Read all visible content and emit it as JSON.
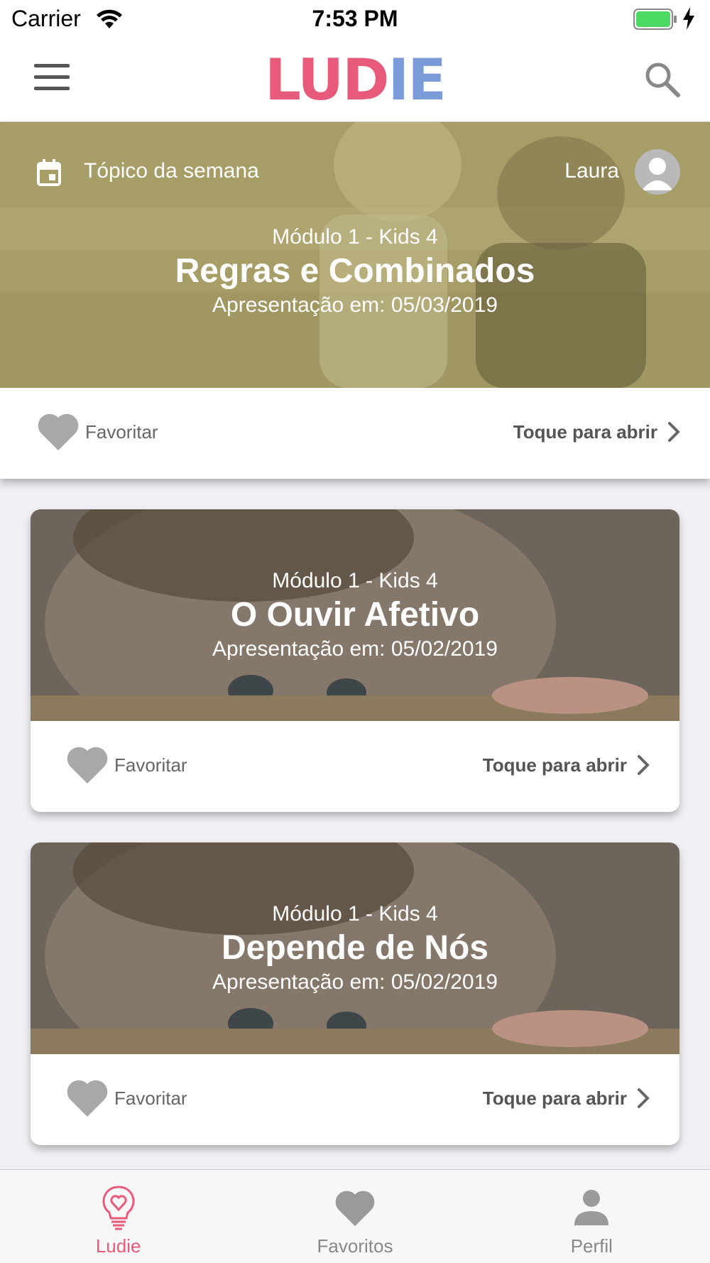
{
  "status_bar": {
    "carrier": "Carrier",
    "time": "7:53 PM",
    "battery_color": "#4cd964"
  },
  "header": {
    "logo_letters": [
      "L",
      "U",
      "D",
      "I",
      "E"
    ],
    "logo_colors": [
      "#e85a7a",
      "#e85a7a",
      "#e85a7a",
      "#7a9bd8",
      "#7a9bd8"
    ],
    "menu_icon": "hamburger-icon",
    "search_icon": "search-icon"
  },
  "featured": {
    "week_label": "Tópico da semana",
    "user_name": "Laura",
    "module": "Módulo 1 - Kids 4",
    "title": "Regras e Combinados",
    "date": "Apresentação em: 05/03/2019",
    "favorite_label": "Favoritar",
    "open_label": "Toque para abrir"
  },
  "cards": [
    {
      "module": "Módulo 1 - Kids 4",
      "title": "O Ouvir Afetivo",
      "date": "Apresentação em: 05/02/2019",
      "favorite_label": "Favoritar",
      "open_label": "Toque para abrir"
    },
    {
      "module": "Módulo 1 - Kids 4",
      "title": "Depende de Nós",
      "date": "Apresentação em: 05/02/2019",
      "favorite_label": "Favoritar",
      "open_label": "Toque para abrir"
    }
  ],
  "tabs": [
    {
      "label": "Ludie",
      "icon": "lightbulb-heart-icon",
      "active": true
    },
    {
      "label": "Favoritos",
      "icon": "heart-icon",
      "active": false
    },
    {
      "label": "Perfil",
      "icon": "person-icon",
      "active": false
    }
  ],
  "colors": {
    "accent": "#e85a7a",
    "featured_tint": "#a8a068",
    "card_tint": "#6e655c"
  }
}
